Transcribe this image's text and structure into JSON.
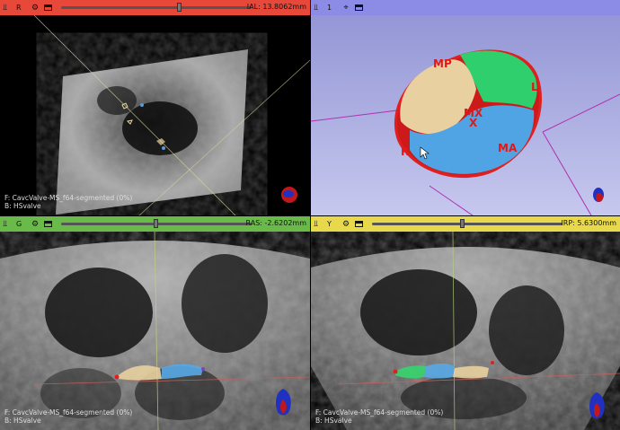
{
  "views": {
    "red": {
      "label": "R",
      "readout": "IAL: 13.8062mm",
      "caption_f": "F: CavcValve-MS_f64-segmented (0%)",
      "caption_b": "B: HSvalve",
      "slider_fraction": 0.56,
      "color": "#e8483a"
    },
    "threeD": {
      "label": "1",
      "color": "#8c8ce6",
      "markers": [
        "MP",
        "L",
        "MX",
        "X",
        "R",
        "MA"
      ]
    },
    "green": {
      "label": "G",
      "readout": "RAS: -2.6202mm",
      "caption_f": "F: CavcValve-MS_f64-segmented (0%)",
      "caption_b": "B: HSvalve",
      "slider_fraction": 0.49,
      "color": "#6aba4a"
    },
    "yellow": {
      "label": "Y",
      "readout": "IRP: 5.6300mm",
      "caption_f": "F: CavcValve-MS_f64-segmented (0%)",
      "caption_b": "B: HSvalve",
      "slider_fraction": 0.47,
      "color": "#e8d84c"
    }
  },
  "icons": {
    "pin": "pin-icon",
    "gear": "gear-icon",
    "window": "window-icon",
    "link": "link-icon"
  }
}
